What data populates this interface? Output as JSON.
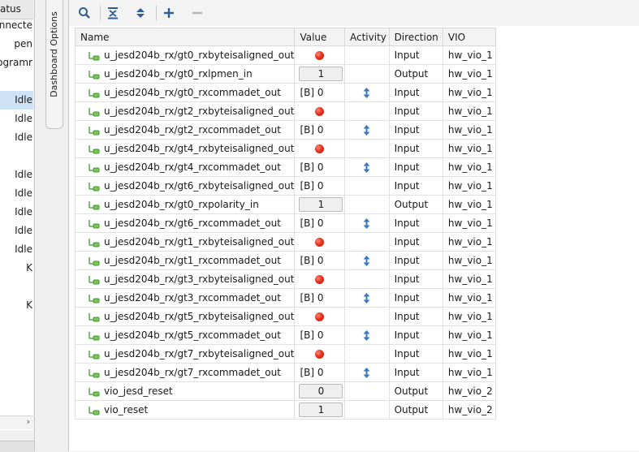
{
  "left_panel": {
    "header": "atus",
    "rows": [
      {
        "text": "onnecte",
        "selected": false
      },
      {
        "text": "pen",
        "selected": false
      },
      {
        "text": "rogramr",
        "selected": false
      },
      {
        "text": "",
        "selected": false
      },
      {
        "text": "Idle",
        "selected": true
      },
      {
        "text": "Idle",
        "selected": false
      },
      {
        "text": "Idle",
        "selected": false
      },
      {
        "text": "",
        "selected": false
      },
      {
        "text": "Idle",
        "selected": false
      },
      {
        "text": "Idle",
        "selected": false
      },
      {
        "text": "Idle",
        "selected": false
      },
      {
        "text": "Idle",
        "selected": false
      },
      {
        "text": "Idle",
        "selected": false
      },
      {
        "text": "K",
        "selected": false
      },
      {
        "text": "",
        "selected": false
      },
      {
        "text": "K",
        "selected": false
      }
    ]
  },
  "dashboard_tab": "Dashboard Options",
  "toolbar": {
    "icons": [
      "search-icon",
      "collapse-all-icon",
      "expand-all-icon",
      "add-icon",
      "remove-icon"
    ]
  },
  "table": {
    "columns": [
      "Name",
      "Value",
      "Activity",
      "Direction",
      "VIO"
    ],
    "rows": [
      {
        "name": "u_jesd204b_rx/gt0_rxbyteisaligned_out",
        "kind": "led",
        "value": "",
        "activity": false,
        "direction": "Input",
        "vio": "hw_vio_1"
      },
      {
        "name": "u_jesd204b_rx/gt0_rxlpmen_in",
        "kind": "box",
        "value": "1",
        "activity": false,
        "direction": "Output",
        "vio": "hw_vio_1"
      },
      {
        "name": "u_jesd204b_rx/gt0_rxcommadet_out",
        "kind": "text",
        "value": "[B] 0",
        "activity": true,
        "direction": "Input",
        "vio": "hw_vio_1"
      },
      {
        "name": "u_jesd204b_rx/gt2_rxbyteisaligned_out",
        "kind": "led",
        "value": "",
        "activity": false,
        "direction": "Input",
        "vio": "hw_vio_1"
      },
      {
        "name": "u_jesd204b_rx/gt2_rxcommadet_out",
        "kind": "text",
        "value": "[B] 0",
        "activity": true,
        "direction": "Input",
        "vio": "hw_vio_1"
      },
      {
        "name": "u_jesd204b_rx/gt4_rxbyteisaligned_out",
        "kind": "led",
        "value": "",
        "activity": false,
        "direction": "Input",
        "vio": "hw_vio_1"
      },
      {
        "name": "u_jesd204b_rx/gt4_rxcommadet_out",
        "kind": "text",
        "value": "[B] 0",
        "activity": true,
        "direction": "Input",
        "vio": "hw_vio_1"
      },
      {
        "name": "u_jesd204b_rx/gt6_rxbyteisaligned_out",
        "kind": "text",
        "value": "[B] 0",
        "activity": false,
        "direction": "Input",
        "vio": "hw_vio_1"
      },
      {
        "name": "u_jesd204b_rx/gt0_rxpolarity_in",
        "kind": "box",
        "value": "1",
        "activity": false,
        "direction": "Output",
        "vio": "hw_vio_1"
      },
      {
        "name": "u_jesd204b_rx/gt6_rxcommadet_out",
        "kind": "text",
        "value": "[B] 0",
        "activity": true,
        "direction": "Input",
        "vio": "hw_vio_1"
      },
      {
        "name": "u_jesd204b_rx/gt1_rxbyteisaligned_out",
        "kind": "led",
        "value": "",
        "activity": false,
        "direction": "Input",
        "vio": "hw_vio_1"
      },
      {
        "name": "u_jesd204b_rx/gt1_rxcommadet_out",
        "kind": "text",
        "value": "[B] 0",
        "activity": true,
        "direction": "Input",
        "vio": "hw_vio_1"
      },
      {
        "name": "u_jesd204b_rx/gt3_rxbyteisaligned_out",
        "kind": "led",
        "value": "",
        "activity": false,
        "direction": "Input",
        "vio": "hw_vio_1"
      },
      {
        "name": "u_jesd204b_rx/gt3_rxcommadet_out",
        "kind": "text",
        "value": "[B] 0",
        "activity": true,
        "direction": "Input",
        "vio": "hw_vio_1"
      },
      {
        "name": "u_jesd204b_rx/gt5_rxbyteisaligned_out",
        "kind": "led",
        "value": "",
        "activity": false,
        "direction": "Input",
        "vio": "hw_vio_1"
      },
      {
        "name": "u_jesd204b_rx/gt5_rxcommadet_out",
        "kind": "text",
        "value": "[B] 0",
        "activity": true,
        "direction": "Input",
        "vio": "hw_vio_1"
      },
      {
        "name": "u_jesd204b_rx/gt7_rxbyteisaligned_out",
        "kind": "led",
        "value": "",
        "activity": false,
        "direction": "Input",
        "vio": "hw_vio_1"
      },
      {
        "name": "u_jesd204b_rx/gt7_rxcommadet_out",
        "kind": "text",
        "value": "[B] 0",
        "activity": true,
        "direction": "Input",
        "vio": "hw_vio_1"
      },
      {
        "name": "vio_jesd_reset",
        "kind": "box",
        "value": "0",
        "activity": false,
        "direction": "Output",
        "vio": "hw_vio_2"
      },
      {
        "name": "vio_reset",
        "kind": "box",
        "value": "1",
        "activity": false,
        "direction": "Output",
        "vio": "hw_vio_2"
      }
    ]
  },
  "colors": {
    "led_red": "#e8321e",
    "activity_blue": "#3a78c2",
    "signal_green": "#3f9b2e",
    "selected_row": "#cfe3f6"
  }
}
